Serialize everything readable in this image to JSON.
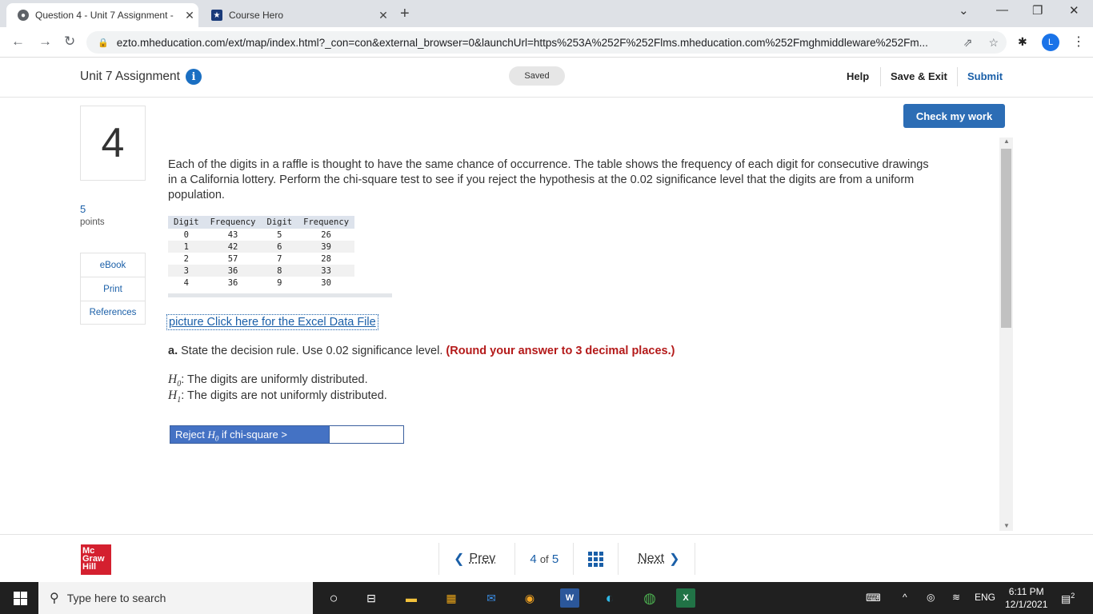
{
  "browser": {
    "tabs": [
      {
        "title": "Question 4 - Unit 7 Assignment -",
        "active": true
      },
      {
        "title": "Course Hero",
        "active": false
      }
    ],
    "url": "ezto.mheducation.com/ext/map/index.html?_con=con&external_browser=0&launchUrl=https%253A%252F%252Flms.mheducation.com%252Fmghmiddleware%252Fm...",
    "profile_initial": "L"
  },
  "header": {
    "title": "Unit 7 Assignment",
    "saved": "Saved",
    "help": "Help",
    "save_exit": "Save & Exit",
    "submit": "Submit"
  },
  "question": {
    "number": "4",
    "points_value": "5",
    "points_label": "points",
    "check_label": "Check my work",
    "prompt": "Each of the digits in a raffle is thought to have the same chance of occurrence. The table shows the frequency of each digit for consecutive drawings in a California lottery. Perform the chi-square test to see if you reject the hypothesis at the 0.02 significance level that the digits are from a uniform population.",
    "table": {
      "headers": [
        "Digit",
        "Frequency",
        "Digit",
        "Frequency"
      ],
      "rows": [
        [
          "0",
          "43",
          "5",
          "26"
        ],
        [
          "1",
          "42",
          "6",
          "39"
        ],
        [
          "2",
          "57",
          "7",
          "28"
        ],
        [
          "3",
          "36",
          "8",
          "33"
        ],
        [
          "4",
          "36",
          "9",
          "30"
        ]
      ]
    },
    "excel_link": "picture Click here for the Excel Data File",
    "part_a_label": "a.",
    "part_a_text": "State the decision rule. Use 0.02 significance level.",
    "part_a_note": "(Round your answer to 3 decimal places.)",
    "h0_text": ": The digits are uniformly distributed.",
    "h1_text": ": The digits are not uniformly distributed.",
    "reject_prefix": "Reject ",
    "reject_suffix": " if chi-square >",
    "answer_value": ""
  },
  "sidebar": {
    "ebook": "eBook",
    "print": "Print",
    "references": "References"
  },
  "footer": {
    "logo_text": "Mc Graw Hill",
    "prev": "Prev",
    "current": "4",
    "of": "of",
    "total": "5",
    "next": "Next"
  },
  "taskbar": {
    "search_placeholder": "Type here to search",
    "lang": "ENG",
    "time": "6:11 PM",
    "date": "12/1/2021",
    "notif_count": "2"
  },
  "colors": {
    "accent": "#2c6db5",
    "link": "#1a5fa8",
    "warning_red": "#b41a1a",
    "brand_red": "#d4202f"
  }
}
